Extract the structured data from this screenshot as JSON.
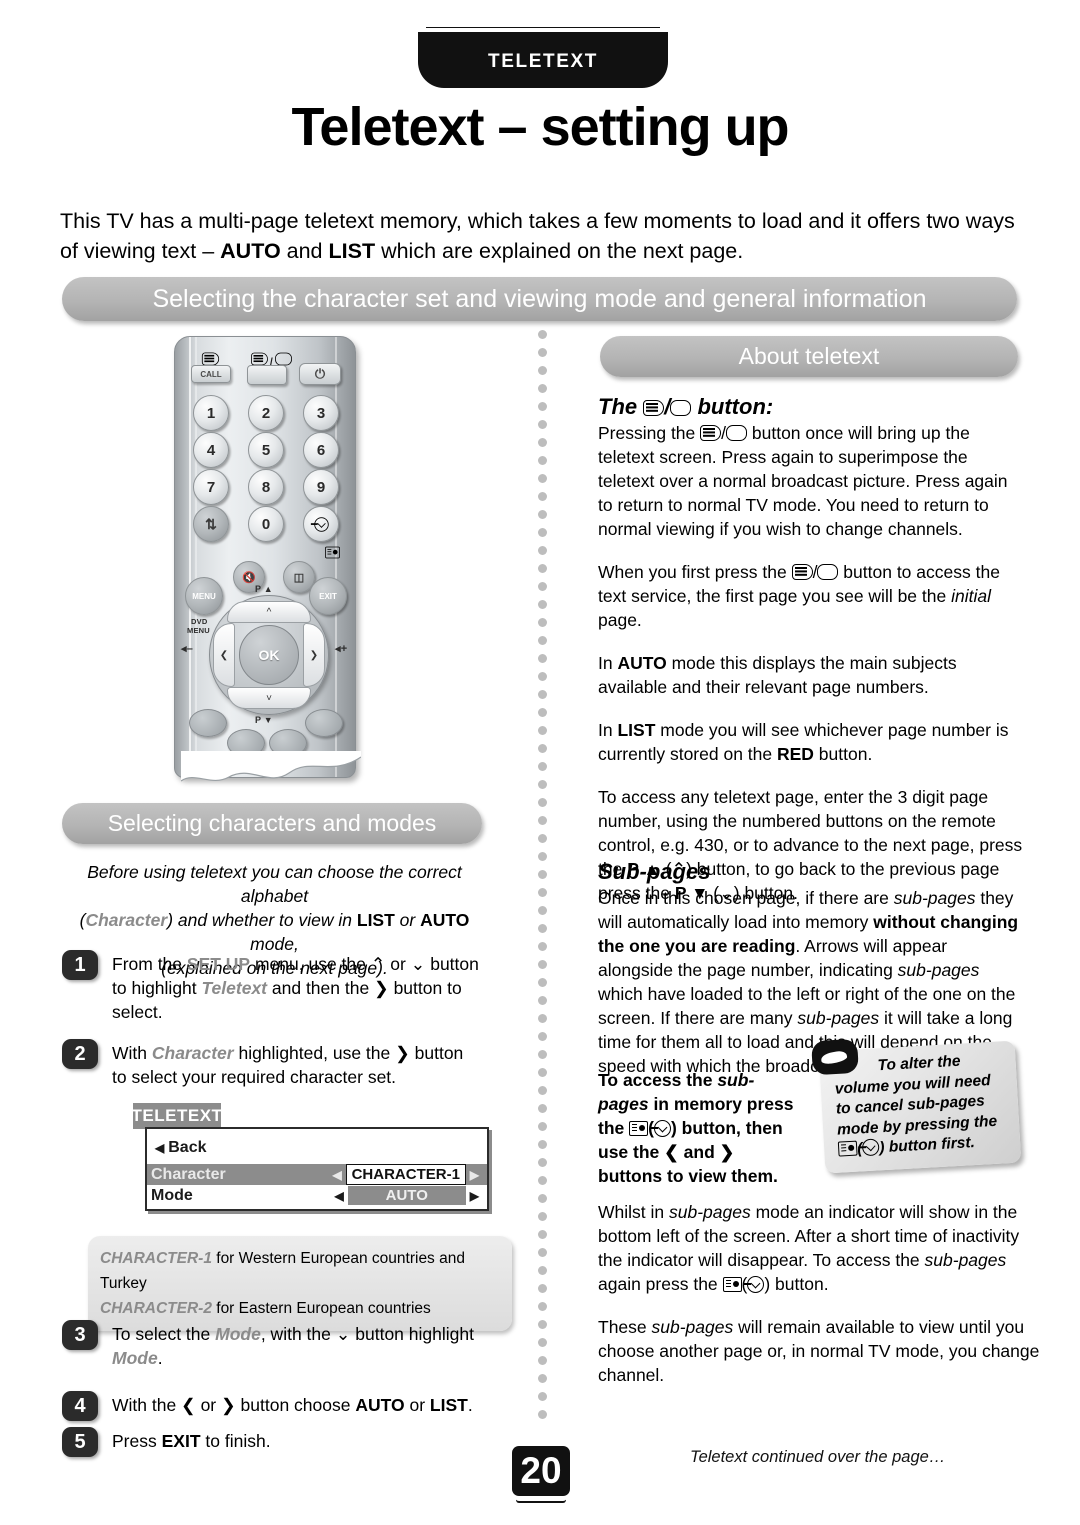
{
  "header": {
    "tab_label": "TELETEXT",
    "title": "Teletext – setting up"
  },
  "intro": {
    "line1_a": "This TV has a multi-page teletext memory, which takes a few moments to load and it offers two ways of viewing text – ",
    "bold1": "AUTO",
    "line1_b": " and ",
    "bold2": "LIST",
    "line1_c": " which are explained on the next page."
  },
  "banners": {
    "section": "Selecting the character set and viewing mode and general information",
    "characters": "Selecting characters and modes",
    "about": "About teletext"
  },
  "remote": {
    "keys": {
      "call": "CALL",
      "k1": "1",
      "k2": "2",
      "k3": "3",
      "k4": "4",
      "k5": "5",
      "k6": "6",
      "k7": "7",
      "k8": "8",
      "k9": "9",
      "k0": "0",
      "menu": "MENU",
      "dvd_menu_line1": "DVD",
      "dvd_menu_line2": "MENU",
      "exit": "EXIT",
      "ok": "OK",
      "p_up": "P ▲",
      "p_down": "P ▼"
    }
  },
  "about": {
    "heading_pre": "The ",
    "heading_post": " button:",
    "p1_a": "Pressing the ",
    "p1_b": " button once will bring up the teletext screen. Press again to superimpose the teletext over a normal broadcast picture. Press again to return to normal TV mode. You need to return to normal viewing if you wish to change channels.",
    "p2_a": "When you first press the ",
    "p2_b": " button to access the text service, the first page you see will be the ",
    "p2_italic": "initial",
    "p2_c": " page.",
    "p3_a": "In ",
    "p3_bold": "AUTO",
    "p3_b": " mode this displays the main subjects available and their relevant page numbers.",
    "p4_a": "In ",
    "p4_bold": "LIST",
    "p4_b": " mode you will see whichever page number is currently stored on the ",
    "p4_bold2": "RED",
    "p4_c": " button.",
    "p5_a": "To access any teletext page, enter the 3 digit page number, using the numbered buttons on the remote control, e.g. 430, or to advance to the next page, press the ",
    "p5_bold1": "P ▲",
    "p5_b": " (⌃) button, to go back to the previous page press the ",
    "p5_bold2": "P ▼",
    "p5_c": " (⌄) button."
  },
  "subpages": {
    "heading": "Sub-pages",
    "p1_a": "Once in this chosen page, if there are ",
    "p1_i1": "sub-pages",
    "p1_b": " they will automatically load into memory ",
    "p1_bold1": "without changing the one you are reading",
    "p1_c": ". Arrows will appear alongside the page number, indicating ",
    "p1_i2": "sub-pages",
    "p1_d": " which have loaded to the left or right of the one on the screen. If there are many ",
    "p1_i3": "sub-pages",
    "p1_e": " it will take a long time for them all to load and this will depend on the speed with which the broadcaster transmits them.",
    "access_a": "To access the ",
    "access_i": "sub-pages",
    "access_b": " in memory press the ",
    "access_c": " button, then use the ",
    "access_arrows": "❮ and ❯",
    "access_d": " buttons to view them.",
    "p3_a": "Whilst in ",
    "p3_i1": "sub-pages",
    "p3_b": " mode an indicator will show in the bottom left of the screen. After a short time of inactivity the indicator will disappear. To access the ",
    "p3_i2": "sub-pages",
    "p3_c": " again press the ",
    "p3_d": " button.",
    "p4_a": "These ",
    "p4_i": "sub-pages",
    "p4_b": " will remain available to view until you choose another page or, in normal TV mode, you change channel."
  },
  "characters_intro": {
    "l1": "Before using teletext you can choose the correct alphabet",
    "l2_a": "(",
    "l2_gry": "Character",
    "l2_b": ") and whether to view in ",
    "l2_bold1": "LIST",
    "l2_c": " or ",
    "l2_bold2": "AUTO",
    "l2_d": " mode,",
    "l3": "(explained on the next page)."
  },
  "steps": [
    {
      "num": "1",
      "a": "From the ",
      "bold1": "SET UP",
      "b": " menu, use the ⌃ or ⌄ button to highlight ",
      "gry1": "Teletext",
      "c": " and then the ❯ button to select."
    },
    {
      "num": "2",
      "a": "With ",
      "gry1": "Character",
      "b": " highlighted, use the ❯ button to select your required character set."
    },
    {
      "num": "3",
      "a": "To select the ",
      "gry1": "Mode",
      "b": ", with the ⌄ button highlight ",
      "gry2": "Mode",
      "c": "."
    },
    {
      "num": "4",
      "a": "With the ❮ or ❯ button choose ",
      "bold1": "AUTO",
      "b": " or ",
      "bold2": "LIST",
      "c": "."
    },
    {
      "num": "5",
      "a": "Press ",
      "bold1": "EXIT",
      "b": " to finish."
    }
  ],
  "osd": {
    "title": "TELETEXT",
    "back_label": "Back",
    "rows": [
      {
        "name": "Character",
        "value": "CHARACTER-1"
      },
      {
        "name": "Mode",
        "value": "AUTO"
      }
    ]
  },
  "charnote": {
    "l1_bold": "CHARACTER-1",
    "l1_rest": " for Western European countries and Turkey",
    "l2_bold": "CHARACTER-2",
    "l2_rest": " for Eastern European countries"
  },
  "callout": {
    "a": "To alter the volume you will need to cancel ",
    "i": "sub-pages",
    "b": " mode by pressing the ",
    "c": " button first."
  },
  "footer": {
    "page_number": "20",
    "note": "Teletext continued over the page…"
  },
  "colors": {
    "ink": "#000000",
    "banner_grey": "#b4b4b4",
    "osd_grey": "#8c8c8c",
    "label_grey": "#8b8b8b",
    "dot_grey": "#bdbdbd"
  }
}
